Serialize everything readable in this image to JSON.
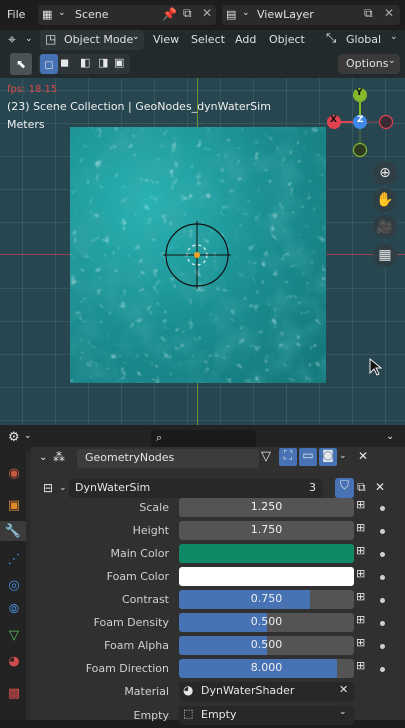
{
  "topbar": {
    "file_label": "File",
    "scene_name": "Scene",
    "viewlayer_name": "ViewLayer"
  },
  "header": {
    "mode_label": "Object Mode",
    "menus": [
      "View",
      "Select",
      "Add",
      "Object"
    ],
    "transform_orientation": "Global",
    "options_label": "Options"
  },
  "viewport": {
    "fps": "fps: 18.15",
    "collection_info": "(23) Scene Collection | GeoNodes_dynWaterSim",
    "units": "Meters",
    "gizmo": {
      "x": "X",
      "y": "Y",
      "z": "Z"
    }
  },
  "properties": {
    "modifier_name": "GeometryNodes",
    "node_group_name": "DynWaterSim",
    "user_count": "3",
    "fields": [
      {
        "label": "Scale",
        "value": "1.250",
        "fill": 0
      },
      {
        "label": "Height",
        "value": "1.750",
        "fill": 0
      },
      {
        "label": "Main Color",
        "type": "color",
        "color": "#0e8a67"
      },
      {
        "label": "Foam Color",
        "type": "color",
        "color": "#ffffff"
      },
      {
        "label": "Contrast",
        "value": "0.750",
        "fill": 0.75
      },
      {
        "label": "Foam Density",
        "value": "0.500",
        "fill": 0.5
      },
      {
        "label": "Foam Alpha",
        "value": "0.500",
        "fill": 0.5
      },
      {
        "label": "Foam Direction",
        "value": "8.000",
        "fill": 0.9
      }
    ],
    "material_label": "Material",
    "material_value": "DynWaterShader",
    "empty_label": "Empty",
    "empty_value": "Empty"
  },
  "colors": {
    "accent": "#4772b3",
    "viewport_bg": "#27464f",
    "x_axis": "#e0434f",
    "y_axis": "#86b82b",
    "z_axis": "#3d87e8"
  }
}
